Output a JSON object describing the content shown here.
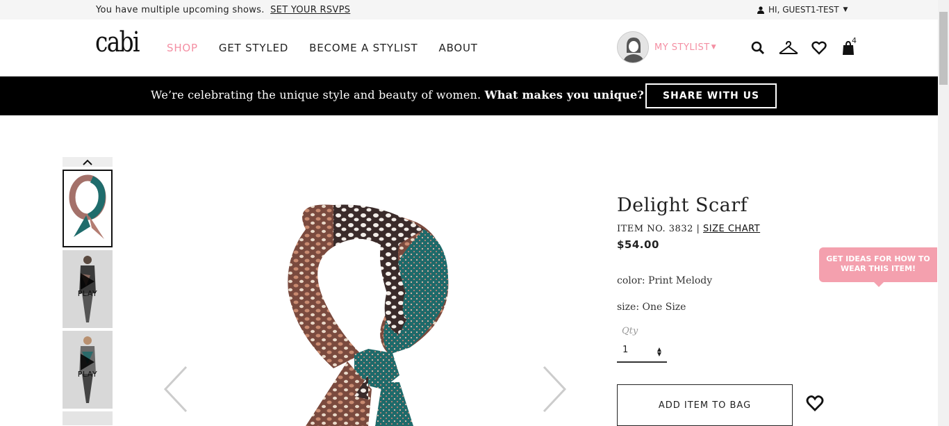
{
  "topbar": {
    "message": "You have multiple upcoming shows.",
    "rsvp_link": "SET YOUR RSVPS",
    "user_greeting": "HI, GUEST1-TEST"
  },
  "header": {
    "logo": "cabi",
    "nav": [
      "SHOP",
      "GET STYLED",
      "BECOME A STYLIST",
      "ABOUT"
    ],
    "my_stylist": "MY STYLIST",
    "bag_count": "4"
  },
  "banner": {
    "text": "We’re celebrating the unique style and beauty of women.",
    "bold_text": "What makes you unique?",
    "button": "SHARE WITH US"
  },
  "gallery": {
    "thumbs": [
      {
        "label": ""
      },
      {
        "label": "PLAY"
      },
      {
        "label": "PLAY"
      }
    ]
  },
  "product": {
    "title": "Delight Scarf",
    "item_no": "ITEM NO. 3832",
    "size_chart": "SIZE CHART",
    "price": "$54.00",
    "color_label": "color:",
    "color_value": "Print Melody",
    "size_label": "size:",
    "size_value": "One Size",
    "qty_label": "Qty",
    "qty_value": "1",
    "add_to_bag": "ADD ITEM TO BAG"
  },
  "ideas_tab": "GET IDEAS FOR HOW TO WEAR THIS ITEM!",
  "colors": {
    "accent_pink": "#f48fa3",
    "banner_bg": "#000000",
    "ideas_bg": "#f4a0ae"
  }
}
